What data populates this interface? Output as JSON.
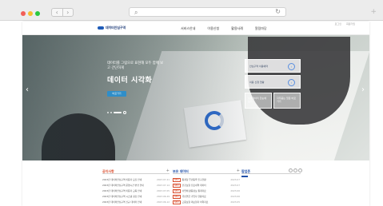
{
  "browser": {
    "back": "‹",
    "forward": "›",
    "search_icon": "⌕",
    "reload_icon": "↻",
    "new_tab": "+"
  },
  "header": {
    "logo": "데이터안심구역",
    "top_links": [
      "로그인",
      "회원가입"
    ],
    "nav": [
      "서비스안내",
      "이용신청",
      "활용사례",
      "알림마당"
    ]
  },
  "hero": {
    "subtitle": "데이터를 그림으로 표현해 모두 함께 보고 간단하게",
    "title": "데이터 시각화",
    "button": "바로가기",
    "quick_cards": [
      "안심구역 이용예약",
      "이용 신청 현황"
    ],
    "quick_squares": [
      "보유데이터 한눈에 보기",
      "자주묻는 질문 바로가기"
    ]
  },
  "boards": {
    "notice": {
      "title": "공지사항",
      "more": "+",
      "rows": [
        {
          "text": "2023년 데이터안심구역 이용자 모집 안내",
          "date": "2023.07.21"
        },
        {
          "text": "2023년 데이터안심구역 운영시간 변경 안내",
          "date": "2023.07.14"
        },
        {
          "text": "2023년 데이터안심구역 이용자 교육 안내",
          "date": "2023.07.05"
        },
        {
          "text": "2023년 데이터안심구역 시스템 점검 안내",
          "date": "2023.06.29"
        },
        {
          "text": "2023년 데이터안심구역 신규 데이터 안내",
          "date": "2023.06.12"
        }
      ]
    },
    "datasets": {
      "title": "보유 데이터",
      "more": "+",
      "rows": [
        {
          "tag": "NEW",
          "text": "통계청 주민등록 인구현황",
          "date": "2023.07"
        },
        {
          "tag": "NEW",
          "text": "건강보험 진료내역 데이터",
          "date": "2023.07"
        },
        {
          "tag": "NEW",
          "text": "사업체 활동정보 통계자료",
          "date": "2023.06"
        },
        {
          "tag": "NEW",
          "text": "국민연금 가입자 현황자료",
          "date": "2023.06"
        },
        {
          "tag": "NEW",
          "text": "고용보험 피보험자 이력자료",
          "date": "2023.05"
        }
      ]
    },
    "popup": {
      "title": "팝업존"
    }
  }
}
